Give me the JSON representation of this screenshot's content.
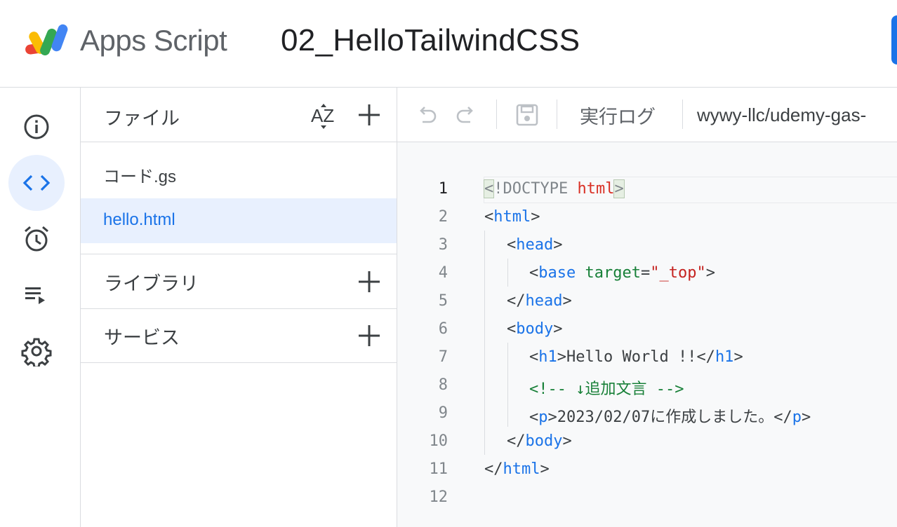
{
  "header": {
    "brand": "Apps Script",
    "project_title": "02_HelloTailwindCSS"
  },
  "rail": {
    "items": [
      {
        "icon": "info-icon"
      },
      {
        "icon": "code-icon",
        "active": true
      },
      {
        "icon": "alarm-clock-icon"
      },
      {
        "icon": "execution-log-icon"
      },
      {
        "icon": "gear-icon"
      }
    ]
  },
  "files_panel": {
    "title": "ファイル",
    "sort_label": "AZ",
    "files": [
      {
        "name": "コード.gs",
        "active": false
      },
      {
        "name": "hello.html",
        "active": true
      }
    ],
    "libraries_label": "ライブラリ",
    "services_label": "サービス"
  },
  "toolbar": {
    "execution_log_label": "実行ログ",
    "repo_text": "wywy-llc/udemy-gas-"
  },
  "editor": {
    "line_numbers": [
      "1",
      "2",
      "3",
      "4",
      "5",
      "6",
      "7",
      "8",
      "9",
      "10",
      "11",
      "12"
    ],
    "lines": {
      "l1": {
        "lt": "<",
        "doctype": "!DOCTYPE",
        "html": "html",
        "gt": ">"
      },
      "l2": {
        "open": "<",
        "tag": "html",
        "close": ">"
      },
      "l3": {
        "open": "<",
        "tag": "head",
        "close": ">"
      },
      "l4": {
        "open": "<",
        "tag": "base",
        "attr": "target",
        "eq": "=",
        "val": "\"_top\"",
        "close": ">"
      },
      "l5": {
        "open": "</",
        "tag": "head",
        "close": ">"
      },
      "l6": {
        "open": "<",
        "tag": "body",
        "close": ">"
      },
      "l7": {
        "open": "<",
        "tag": "h1",
        "mid_close": ">",
        "text": "Hello World !!",
        "end_open": "</",
        "end_tag": "h1",
        "close": ">"
      },
      "l8": {
        "comment": "<!-- ↓追加文言 -->"
      },
      "l9": {
        "open": "<",
        "tag": "p",
        "mid_close": ">",
        "text": "2023/02/07に作成しました。",
        "end_open": "</",
        "end_tag": "p",
        "close": ">"
      },
      "l10": {
        "open": "</",
        "tag": "body",
        "close": ">"
      },
      "l11": {
        "open": "</",
        "tag": "html",
        "close": ">"
      }
    }
  },
  "colors": {
    "accent": "#1a73e8",
    "active_bg": "#e8f0fe",
    "tag": "#1a73e8",
    "attribute": "#188038",
    "string": "#c5221f",
    "comment": "#188038"
  }
}
